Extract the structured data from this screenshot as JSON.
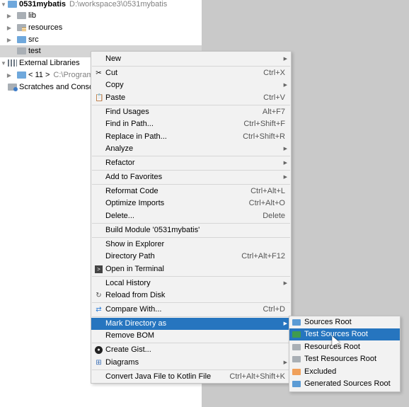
{
  "tree": {
    "project": {
      "name": "0531mybatis",
      "path": "D:\\workspace3\\0531mybatis"
    },
    "items": [
      {
        "label": "lib",
        "icon": "folder-icon"
      },
      {
        "label": "resources",
        "icon": "resources-folder-icon"
      },
      {
        "label": "src",
        "icon": "source-folder-icon"
      },
      {
        "label": "test",
        "icon": "folder-icon"
      }
    ],
    "external_libraries": "External Libraries",
    "jdk": {
      "label": "< 11 >",
      "path": "C:\\Program"
    },
    "scratches": "Scratches and Consol"
  },
  "menu": {
    "items": [
      {
        "label": "New",
        "shortcut": "",
        "submenu": true
      },
      {
        "label": "Cut",
        "shortcut": "Ctrl+X",
        "icon": "cut-icon"
      },
      {
        "label": "Copy",
        "shortcut": "",
        "submenu": true
      },
      {
        "label": "Paste",
        "shortcut": "Ctrl+V",
        "icon": "paste-icon"
      },
      {
        "label": "Find Usages",
        "shortcut": "Alt+F7"
      },
      {
        "label": "Find in Path...",
        "shortcut": "Ctrl+Shift+F"
      },
      {
        "label": "Replace in Path...",
        "shortcut": "Ctrl+Shift+R"
      },
      {
        "label": "Analyze",
        "shortcut": "",
        "submenu": true
      },
      {
        "label": "Refactor",
        "shortcut": "",
        "submenu": true
      },
      {
        "label": "Add to Favorites",
        "shortcut": "",
        "submenu": true
      },
      {
        "label": "Reformat Code",
        "shortcut": "Ctrl+Alt+L"
      },
      {
        "label": "Optimize Imports",
        "shortcut": "Ctrl+Alt+O"
      },
      {
        "label": "Delete...",
        "shortcut": "Delete"
      },
      {
        "label": "Build Module '0531mybatis'",
        "shortcut": ""
      },
      {
        "label": "Show in Explorer",
        "shortcut": ""
      },
      {
        "label": "Directory Path",
        "shortcut": "Ctrl+Alt+F12"
      },
      {
        "label": "Open in Terminal",
        "shortcut": "",
        "icon": "terminal-icon"
      },
      {
        "label": "Local History",
        "shortcut": "",
        "submenu": true
      },
      {
        "label": "Reload from Disk",
        "shortcut": "",
        "icon": "reload-icon"
      },
      {
        "label": "Compare With...",
        "shortcut": "Ctrl+D",
        "icon": "compare-icon"
      },
      {
        "label": "Mark Directory as",
        "shortcut": "",
        "submenu": true,
        "highlighted": true
      },
      {
        "label": "Remove BOM",
        "shortcut": ""
      },
      {
        "label": "Create Gist...",
        "shortcut": "",
        "icon": "github-icon"
      },
      {
        "label": "Diagrams",
        "shortcut": "",
        "submenu": true,
        "icon": "diagram-icon"
      },
      {
        "label": "Convert Java File to Kotlin File",
        "shortcut": "Ctrl+Alt+Shift+K"
      }
    ]
  },
  "submenu": {
    "items": [
      {
        "label": "Sources Root",
        "color": "#5b9bd5"
      },
      {
        "label": "Test Sources Root",
        "color": "#3f9b4f",
        "highlighted": true
      },
      {
        "label": "Resources Root",
        "color": "#a9afb5"
      },
      {
        "label": "Test Resources Root",
        "color": "#a9afb5"
      },
      {
        "label": "Excluded",
        "color": "#f0a05a"
      },
      {
        "label": "Generated Sources Root",
        "color": "#5b9bd5"
      }
    ]
  }
}
